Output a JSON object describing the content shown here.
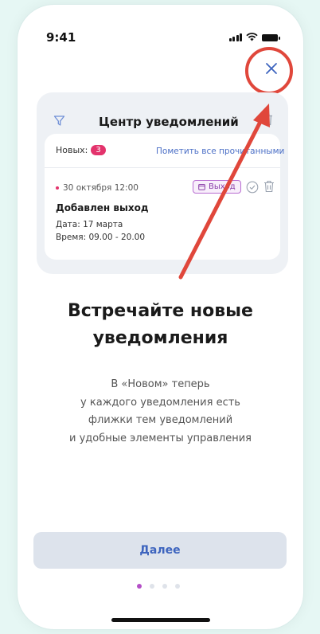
{
  "status_bar": {
    "time": "9:41"
  },
  "notification_center": {
    "title": "Центр уведомлений",
    "new_label": "Новых:",
    "new_count": "3",
    "mark_all_read": "Пометить все прочитанными",
    "notification": {
      "date": "30 октября 12:00",
      "tag": "Выход",
      "title": "Добавлен выход",
      "line1": "Дата: 17 марта",
      "line2": "Время: 09.00 - 20.00"
    }
  },
  "onboarding": {
    "heading_line1": "Встречайте новые",
    "heading_line2": "уведомления",
    "desc_line1": "В «Новом» теперь",
    "desc_line2": "у каждого уведомления есть",
    "desc_line3": "флижки тем уведомлений",
    "desc_line4": "и удобные элементы управления",
    "next_button": "Далее",
    "pager": {
      "count": 4,
      "active": 1
    }
  },
  "colors": {
    "accent": "#3d64be",
    "annotation": "#e0473b",
    "badge": "#e3336c",
    "active_dot": "#b44fc7"
  },
  "icons": [
    "filter-icon",
    "trash-icon",
    "calendar-icon",
    "check-circle-icon",
    "close-icon",
    "arrow-annotation"
  ]
}
